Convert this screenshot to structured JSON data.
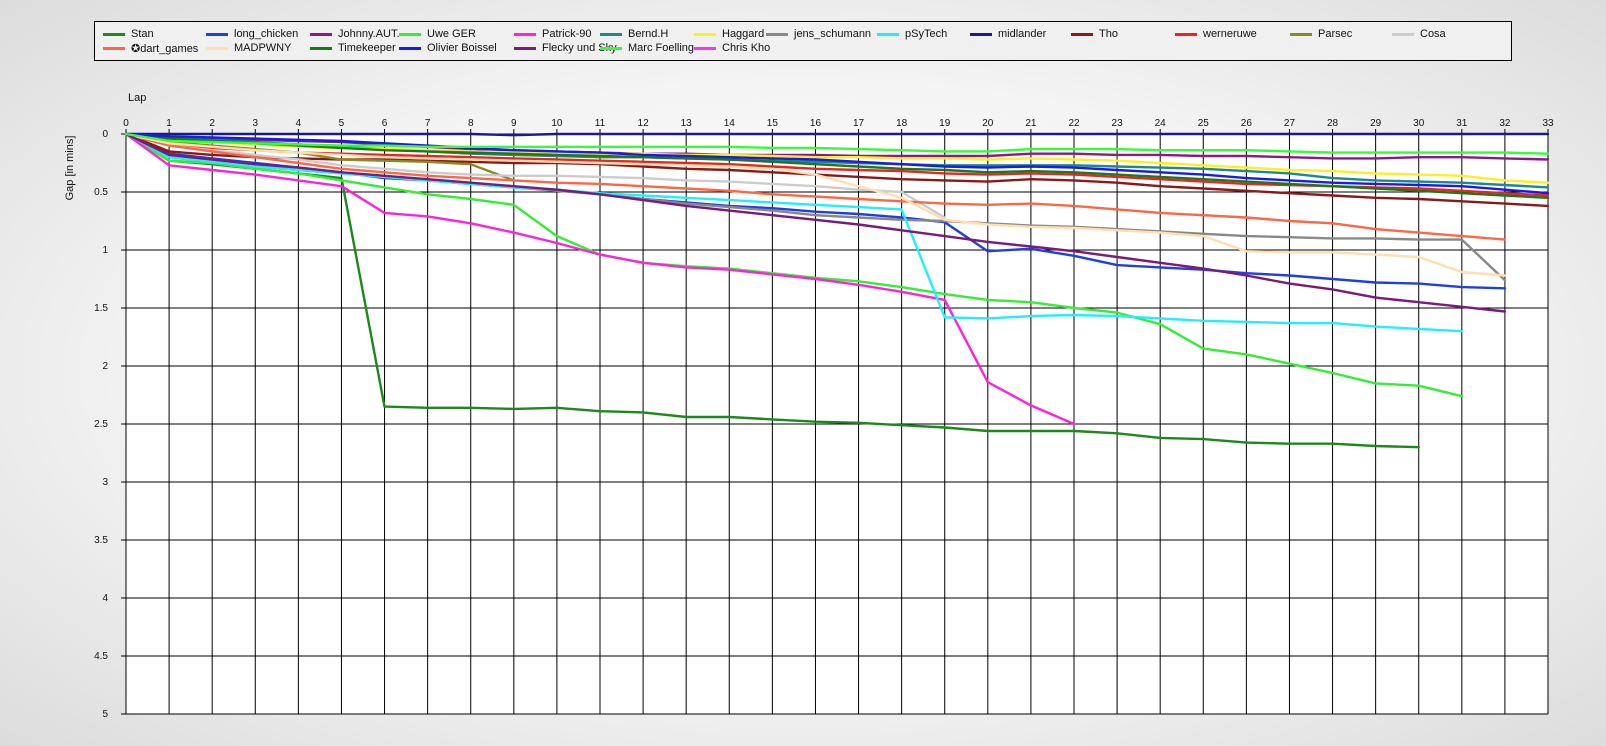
{
  "chart_data": {
    "type": "line",
    "xlabel": "Lap",
    "ylabel": "Gap [in mins]",
    "xlim": [
      0,
      33
    ],
    "ylim": [
      0,
      5
    ],
    "y_inverted": true,
    "grid": true,
    "legend_position": "top",
    "x_ticks": [
      "0",
      "1",
      "2",
      "3",
      "4",
      "5",
      "6",
      "7",
      "8",
      "9",
      "10",
      "11",
      "12",
      "13",
      "14",
      "15",
      "16",
      "17",
      "18",
      "19",
      "20",
      "21",
      "22",
      "23",
      "24",
      "25",
      "26",
      "27",
      "28",
      "29",
      "30",
      "31",
      "32",
      "33"
    ],
    "y_ticks": [
      "0",
      "0.5",
      "1",
      "1.5",
      "2",
      "2.5",
      "3",
      "3.5",
      "4",
      "4.5",
      "5"
    ],
    "series": [
      {
        "name": "Stan",
        "color": "#1a8a1a",
        "values": [
          0,
          0.23,
          0.26,
          0.3,
          0.34,
          0.38,
          2.35,
          2.36,
          2.36,
          2.37,
          2.36,
          2.39,
          2.4,
          2.44,
          2.44,
          2.46,
          2.48,
          2.49,
          2.51,
          2.53,
          2.56,
          2.56,
          2.56,
          2.58,
          2.62,
          2.63,
          2.66,
          2.67,
          2.67,
          2.69,
          2.7
        ]
      },
      {
        "name": "long_chicken",
        "color": "#1f3fe0",
        "values": [
          0,
          0.17,
          0.21,
          0.25,
          0.29,
          0.33,
          0.38,
          0.4,
          0.43,
          0.46,
          0.48,
          0.52,
          0.56,
          0.59,
          0.62,
          0.64,
          0.67,
          0.69,
          0.72,
          0.76,
          1.01,
          0.99,
          1.05,
          1.13,
          1.15,
          1.17,
          1.2,
          1.22,
          1.25,
          1.28,
          1.29,
          1.32,
          1.33
        ]
      },
      {
        "name": "Johnny.AUT.",
        "color": "#8a1a8a",
        "values": [
          0,
          0.03,
          0.04,
          0.05,
          0.06,
          0.07,
          0.09,
          0.11,
          0.13,
          0.14,
          0.15,
          0.16,
          0.17,
          0.17,
          0.18,
          0.18,
          0.18,
          0.19,
          0.19,
          0.19,
          0.19,
          0.17,
          0.17,
          0.18,
          0.18,
          0.19,
          0.19,
          0.2,
          0.21,
          0.21,
          0.2,
          0.2,
          0.21,
          0.22
        ]
      },
      {
        "name": "Uwe GER",
        "color": "#33ee33",
        "values": [
          0,
          0.23,
          0.25,
          0.3,
          0.34,
          0.4,
          0.46,
          0.52,
          0.56,
          0.61,
          0.88,
          1.04,
          1.11,
          1.14,
          1.16,
          1.2,
          1.24,
          1.27,
          1.32,
          1.38,
          1.43,
          1.45,
          1.5,
          1.54,
          1.64,
          1.85,
          1.9,
          1.98,
          2.06,
          2.15,
          2.17,
          2.26
        ]
      },
      {
        "name": "Patrick-90",
        "color": "#ff22dd",
        "values": [
          0,
          0.27,
          0.31,
          0.35,
          0.4,
          0.45,
          0.68,
          0.71,
          0.77,
          0.85,
          0.94,
          1.04,
          1.11,
          1.15,
          1.17,
          1.21,
          1.25,
          1.3,
          1.36,
          1.43,
          2.14,
          2.34,
          2.5
        ]
      },
      {
        "name": "Bernd.H",
        "color": "#1a8a8a",
        "values": [
          0,
          0.03,
          0.05,
          0.07,
          0.09,
          0.11,
          0.13,
          0.15,
          0.17,
          0.18,
          0.19,
          0.2,
          0.2,
          0.21,
          0.22,
          0.23,
          0.24,
          0.25,
          0.26,
          0.27,
          0.27,
          0.27,
          0.27,
          0.28,
          0.29,
          0.3,
          0.32,
          0.34,
          0.38,
          0.4,
          0.41,
          0.42,
          0.44,
          0.46
        ]
      },
      {
        "name": "Haggard",
        "color": "#ffee22",
        "values": [
          0,
          0.05,
          0.07,
          0.09,
          0.11,
          0.12,
          0.13,
          0.14,
          0.15,
          0.16,
          0.16,
          0.17,
          0.17,
          0.18,
          0.18,
          0.19,
          0.2,
          0.2,
          0.21,
          0.21,
          0.22,
          0.21,
          0.22,
          0.23,
          0.25,
          0.27,
          0.29,
          0.31,
          0.32,
          0.34,
          0.35,
          0.36,
          0.4,
          0.42
        ]
      },
      {
        "name": "jens_schumann",
        "color": "#888888",
        "values": [
          0,
          0.2,
          0.24,
          0.28,
          0.31,
          0.34,
          0.37,
          0.4,
          0.43,
          0.46,
          0.49,
          0.52,
          0.56,
          0.6,
          0.63,
          0.66,
          0.7,
          0.72,
          0.74,
          0.75,
          0.77,
          0.79,
          0.8,
          0.82,
          0.84,
          0.86,
          0.88,
          0.89,
          0.9,
          0.9,
          0.91,
          0.91,
          1.26
        ]
      },
      {
        "name": "pSyTech",
        "color": "#22eeff",
        "values": [
          0,
          0.2,
          0.24,
          0.28,
          0.31,
          0.34,
          0.37,
          0.4,
          0.43,
          0.46,
          0.48,
          0.51,
          0.53,
          0.55,
          0.57,
          0.59,
          0.61,
          0.63,
          0.65,
          1.58,
          1.59,
          1.57,
          1.56,
          1.57,
          1.59,
          1.61,
          1.62,
          1.63,
          1.63,
          1.66,
          1.68,
          1.7
        ]
      },
      {
        "name": "midlander",
        "color": "#1a1a8a",
        "values": [
          0,
          0,
          0,
          0,
          0,
          0,
          0,
          0,
          0,
          0.01,
          0,
          0,
          0,
          0,
          0,
          0,
          0,
          0,
          0,
          0,
          0,
          0,
          0,
          0,
          0,
          0,
          0,
          0,
          0,
          0,
          0,
          0,
          0,
          0
        ]
      },
      {
        "name": "Tho",
        "color": "#8a1a1a",
        "values": [
          0,
          0.15,
          0.18,
          0.2,
          0.21,
          0.22,
          0.22,
          0.23,
          0.24,
          0.25,
          0.25,
          0.26,
          0.28,
          0.3,
          0.31,
          0.33,
          0.35,
          0.37,
          0.39,
          0.4,
          0.41,
          0.39,
          0.4,
          0.42,
          0.45,
          0.47,
          0.49,
          0.51,
          0.53,
          0.55,
          0.56,
          0.58,
          0.6,
          0.62
        ]
      },
      {
        "name": "werneruwe",
        "color": "#ee2222",
        "values": [
          0,
          0.09,
          0.12,
          0.14,
          0.16,
          0.17,
          0.18,
          0.19,
          0.2,
          0.21,
          0.22,
          0.23,
          0.24,
          0.25,
          0.26,
          0.28,
          0.3,
          0.31,
          0.32,
          0.34,
          0.35,
          0.34,
          0.35,
          0.37,
          0.39,
          0.41,
          0.43,
          0.44,
          0.45,
          0.46,
          0.47,
          0.49,
          0.51,
          0.53
        ]
      },
      {
        "name": "Parsec",
        "color": "#8a8a22",
        "values": [
          0,
          0.07,
          0.1,
          0.13,
          0.16,
          0.22,
          0.23,
          0.24,
          0.26,
          0.4
        ]
      },
      {
        "name": "Cosa",
        "color": "#cccccc",
        "values": [
          0,
          0.1,
          0.14,
          0.18,
          0.22,
          0.27,
          0.3,
          0.33,
          0.35,
          0.36,
          0.36,
          0.37,
          0.38,
          0.4,
          0.41,
          0.43,
          0.45,
          0.48,
          0.5,
          0.72
        ]
      },
      {
        "name": "✪dart_games",
        "color": "#ff6644",
        "values": [
          0,
          0.1,
          0.15,
          0.2,
          0.25,
          0.3,
          0.33,
          0.36,
          0.38,
          0.4,
          0.42,
          0.43,
          0.45,
          0.47,
          0.49,
          0.52,
          0.54,
          0.56,
          0.58,
          0.6,
          0.61,
          0.6,
          0.62,
          0.65,
          0.68,
          0.7,
          0.72,
          0.75,
          0.77,
          0.82,
          0.85,
          0.88,
          0.91
        ]
      },
      {
        "name": "MADPWNY",
        "color": "#ffdeb0",
        "values": [
          0,
          0.08,
          0.11,
          0.14,
          0.16,
          0.18,
          0.2,
          0.21,
          0.22,
          0.23,
          0.24,
          0.25,
          0.26,
          0.27,
          0.28,
          0.3,
          0.35,
          0.45,
          0.55,
          0.74,
          0.78,
          0.8,
          0.81,
          0.83,
          0.85,
          0.88,
          1.01,
          1.02,
          1.02,
          1.04,
          1.06,
          1.19,
          1.22
        ]
      },
      {
        "name": "Timekeeper",
        "color": "#1a7a1a",
        "values": [
          0,
          0.04,
          0.06,
          0.08,
          0.1,
          0.12,
          0.14,
          0.15,
          0.16,
          0.17,
          0.18,
          0.19,
          0.2,
          0.21,
          0.22,
          0.24,
          0.26,
          0.28,
          0.3,
          0.31,
          0.33,
          0.32,
          0.33,
          0.35,
          0.37,
          0.39,
          0.41,
          0.43,
          0.45,
          0.47,
          0.49,
          0.51,
          0.53,
          0.55
        ]
      },
      {
        "name": "Olivier Boissel",
        "color": "#1a1aee",
        "values": [
          0,
          0.02,
          0.03,
          0.04,
          0.05,
          0.06,
          0.08,
          0.1,
          0.12,
          0.14,
          0.15,
          0.16,
          0.18,
          0.19,
          0.2,
          0.21,
          0.22,
          0.24,
          0.26,
          0.28,
          0.29,
          0.28,
          0.29,
          0.31,
          0.33,
          0.35,
          0.38,
          0.4,
          0.42,
          0.43,
          0.44,
          0.45,
          0.48,
          0.51
        ]
      },
      {
        "name": "Flecky und Sky",
        "color": "#7a1a7a",
        "values": [
          0,
          0.18,
          0.22,
          0.26,
          0.29,
          0.33,
          0.36,
          0.39,
          0.42,
          0.45,
          0.48,
          0.52,
          0.57,
          0.62,
          0.66,
          0.7,
          0.74,
          0.78,
          0.83,
          0.88,
          0.93,
          0.97,
          1.01,
          1.06,
          1.11,
          1.16,
          1.22,
          1.29,
          1.34,
          1.41,
          1.45,
          1.49,
          1.53
        ]
      },
      {
        "name": "Marc Foelling",
        "color": "#33ff33",
        "values": [
          0,
          0.06,
          0.07,
          0.08,
          0.09,
          0.1,
          0.1,
          0.11,
          0.11,
          0.11,
          0.11,
          0.11,
          0.11,
          0.11,
          0.11,
          0.12,
          0.12,
          0.13,
          0.14,
          0.15,
          0.15,
          0.13,
          0.13,
          0.13,
          0.14,
          0.14,
          0.14,
          0.15,
          0.16,
          0.16,
          0.16,
          0.16,
          0.16,
          0.17
        ]
      },
      {
        "name": "Chris Kho",
        "color": "#ff33ee",
        "values": [
          0
        ]
      }
    ]
  }
}
